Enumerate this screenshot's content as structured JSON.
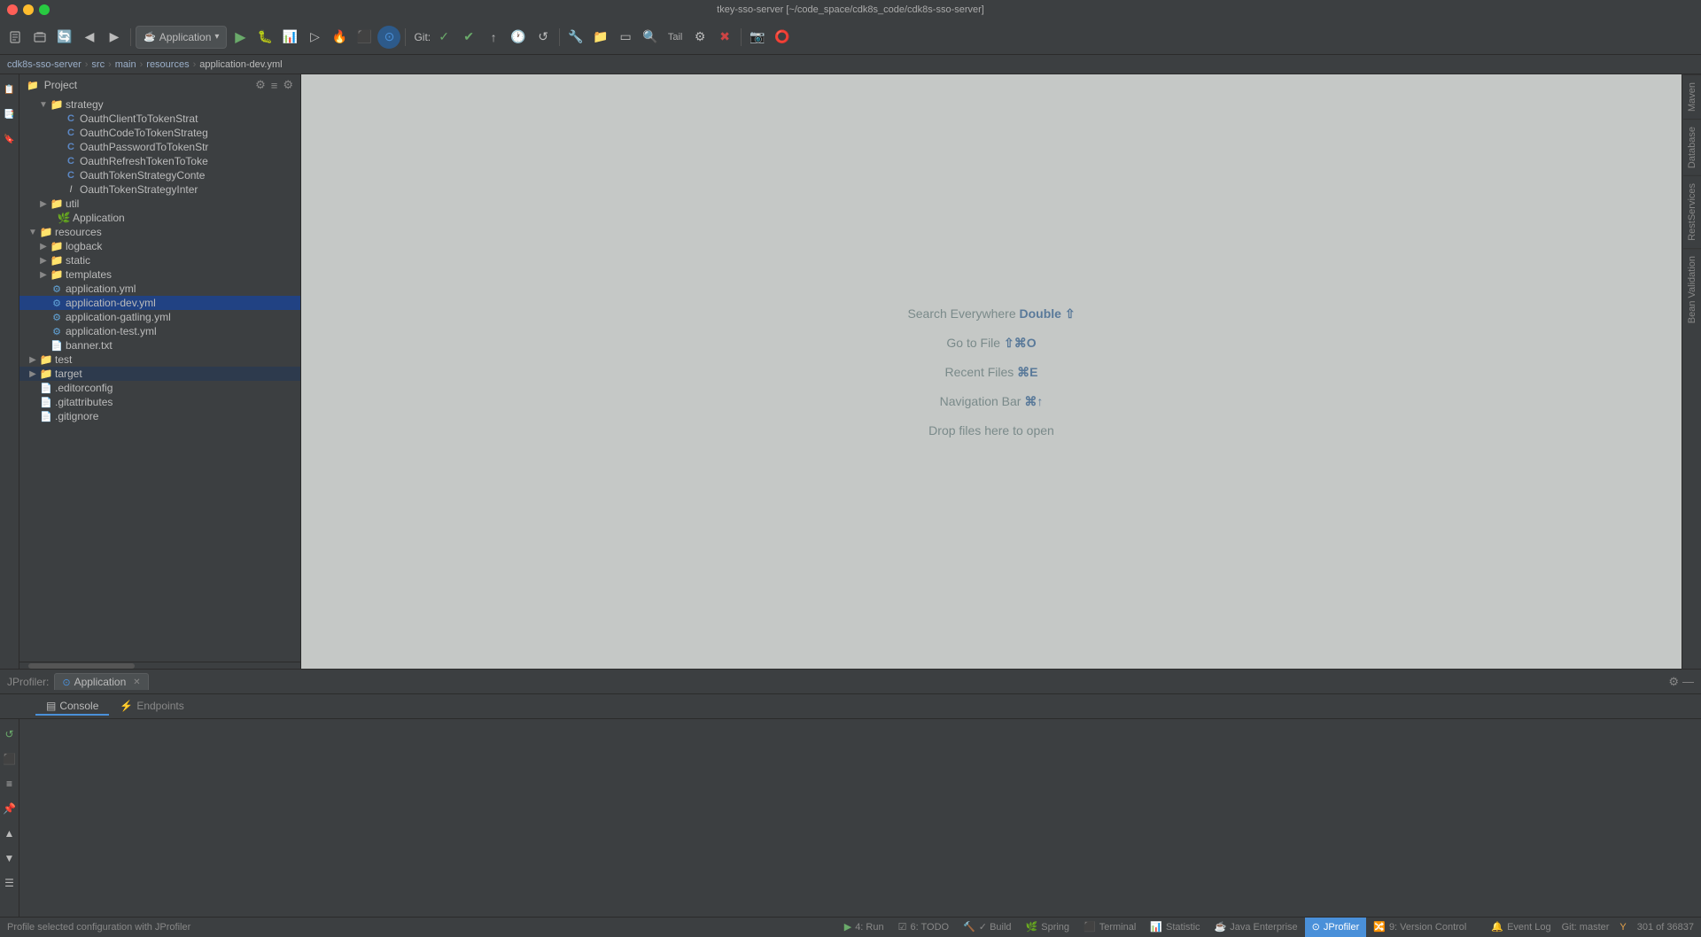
{
  "window": {
    "title": "tkey-sso-server [~/code_space/cdk8s_code/cdk8s-sso-server]"
  },
  "toolbar": {
    "run_config": "Application",
    "git_label": "Git:",
    "tail_label": "Tail"
  },
  "breadcrumb": {
    "items": [
      "cdk8s-sso-server",
      "src",
      "main",
      "resources",
      "application-dev.yml"
    ]
  },
  "project_panel": {
    "title": "Project",
    "items": [
      {
        "indent": 20,
        "type": "folder",
        "label": "strategy",
        "expandable": true
      },
      {
        "indent": 36,
        "type": "class",
        "label": "OauthClientToTokenStrat"
      },
      {
        "indent": 36,
        "type": "class",
        "label": "OauthCodeToTokenStrateg"
      },
      {
        "indent": 36,
        "type": "class",
        "label": "OauthPasswordToTokenStr"
      },
      {
        "indent": 36,
        "type": "class",
        "label": "OauthRefreshTokenToToke"
      },
      {
        "indent": 36,
        "type": "class",
        "label": "OauthTokenStrategyConte"
      },
      {
        "indent": 36,
        "type": "interface",
        "label": "OauthTokenStrategyInter"
      },
      {
        "indent": 20,
        "type": "folder",
        "label": "util",
        "expandable": true
      },
      {
        "indent": 28,
        "type": "spring-app",
        "label": "Application"
      },
      {
        "indent": 8,
        "type": "folder-open",
        "label": "resources",
        "expandable": true
      },
      {
        "indent": 20,
        "type": "folder",
        "label": "logback",
        "expandable": true
      },
      {
        "indent": 20,
        "type": "folder",
        "label": "static",
        "expandable": true
      },
      {
        "indent": 20,
        "type": "folder",
        "label": "templates",
        "expandable": true
      },
      {
        "indent": 20,
        "type": "yml",
        "label": "application.yml"
      },
      {
        "indent": 20,
        "type": "yml",
        "label": "application-dev.yml",
        "selected": true
      },
      {
        "indent": 20,
        "type": "yml",
        "label": "application-gatling.yml"
      },
      {
        "indent": 20,
        "type": "yml",
        "label": "application-test.yml"
      },
      {
        "indent": 20,
        "type": "file",
        "label": "banner.txt"
      },
      {
        "indent": 8,
        "type": "folder",
        "label": "test",
        "expandable": true
      },
      {
        "indent": 8,
        "type": "folder",
        "label": "target",
        "expandable": true,
        "highlighted": true
      },
      {
        "indent": 8,
        "type": "file",
        "label": ".editorconfig"
      },
      {
        "indent": 8,
        "type": "file",
        "label": ".gitattributes"
      },
      {
        "indent": 8,
        "type": "file",
        "label": ".gitignore"
      }
    ]
  },
  "editor": {
    "hints": [
      {
        "text": "Search Everywhere",
        "shortcut": "Double ⇧"
      },
      {
        "text": "Go to File",
        "shortcut": "⇧⌘O"
      },
      {
        "text": "Recent Files",
        "shortcut": "⌘E"
      },
      {
        "text": "Navigation Bar",
        "shortcut": "⌘↑"
      },
      {
        "text": "Drop files here to open",
        "shortcut": ""
      }
    ]
  },
  "right_sidebar": {
    "tabs": [
      "Maven",
      "Database",
      "RestServices",
      "Bean Validation"
    ]
  },
  "bottom_panel": {
    "profiler_label": "JProfiler:",
    "tab_label": "Application",
    "tabs": [
      "Console",
      "Endpoints"
    ],
    "active_tab": "Console"
  },
  "status_bar": {
    "profile_message": "Profile selected configuration with JProfiler",
    "tabs": [
      {
        "label": "4: Run",
        "icon": "▶"
      },
      {
        "label": "6: TODO"
      },
      {
        "label": "✓ Build"
      },
      {
        "label": "Spring"
      },
      {
        "label": "Terminal"
      },
      {
        "label": "Statistic"
      },
      {
        "label": "Java Enterprise"
      },
      {
        "label": "JProfiler",
        "active": true
      },
      {
        "label": "9: Version Control"
      }
    ],
    "right": {
      "event_log": "Event Log",
      "git_branch": "Git: master",
      "line_info": "301 of 36837"
    }
  }
}
